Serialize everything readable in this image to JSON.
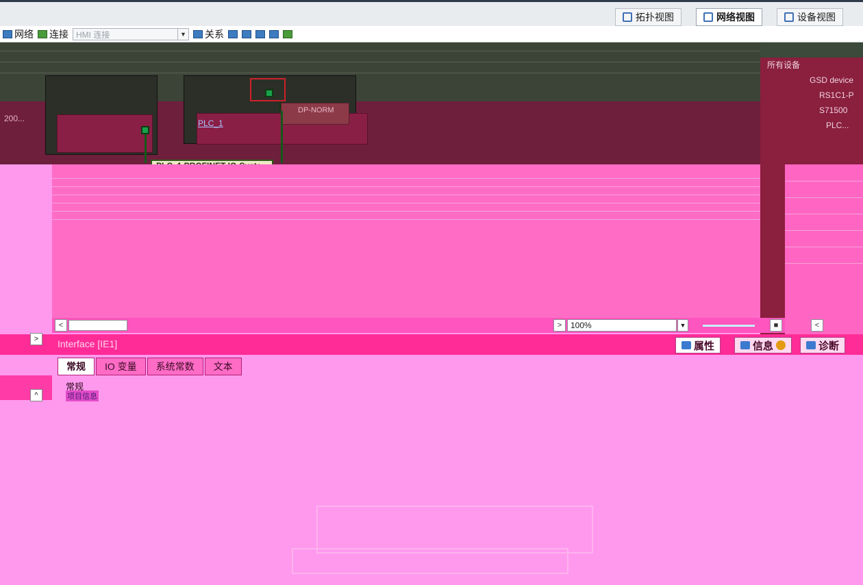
{
  "view_tabs": [
    {
      "label": "拓扑视图",
      "active": false
    },
    {
      "label": "网络视图",
      "active": true
    },
    {
      "label": "设备视图",
      "active": false
    }
  ],
  "toolbar": {
    "network_label": "网络",
    "connections_label": "连接",
    "connection_type_placeholder": "HMI 连接",
    "relations_label": "关系"
  },
  "devices": {
    "plc_name": "PLC_1",
    "dp_status": "DP-NORM",
    "left_device_label": "200..."
  },
  "network": {
    "subnet_label": "PLC_1.PROFINET IO-Syste..."
  },
  "catalog": {
    "filter_label": "所有设备",
    "items": [
      "GSD device",
      "RS1C1-P",
      "S71500",
      "PLC..."
    ]
  },
  "zoom": {
    "value": "100%"
  },
  "properties": {
    "title": "Interface [IE1]",
    "tabs": [
      {
        "label": "属性",
        "active": true
      },
      {
        "label": "信息",
        "active": false
      },
      {
        "label": "诊断",
        "active": false
      }
    ],
    "subtabs": [
      {
        "label": "常规",
        "active": true
      },
      {
        "label": "IO 变量",
        "active": false
      },
      {
        "label": "系统常数",
        "active": false
      },
      {
        "label": "文本",
        "active": false
      }
    ],
    "nav": {
      "general": "常规",
      "section": "项目信息"
    }
  },
  "colors": {
    "accent": "#ff2c97",
    "canvas_dark": "#3c4337",
    "port_green": "#19a04a",
    "selection_red": "#d0202a"
  }
}
